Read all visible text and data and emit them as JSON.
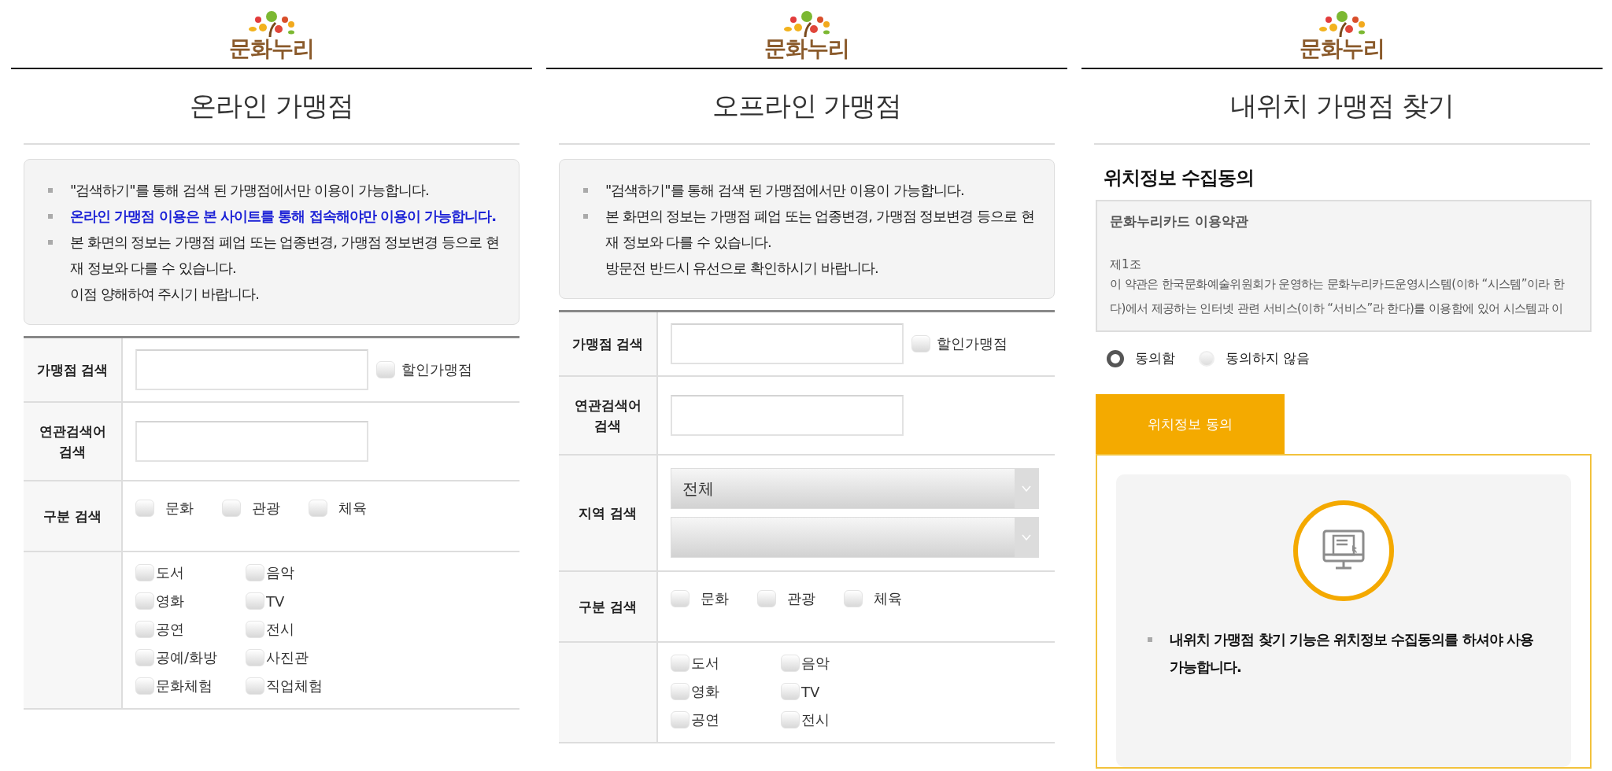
{
  "panels": [
    {
      "logo": "문화누리",
      "title": "온라인 가맹점",
      "kind": "search",
      "notice": [
        {
          "text": "\"검색하기\"를 통해 검색 된 가맹점에서만 이용이 가능합니다.",
          "emphasis": false
        },
        {
          "text": "온라인 가맹점 이용은 본 사이트를 통해 접속해야만 이용이 가능합니다.",
          "emphasis": true
        },
        {
          "text": "본 화면의 정보는 가맹점 폐업 또는 업종변경, 가맹점 정보변경 등으로 현재 정보와 다를 수 있습니다.",
          "emphasis": false,
          "note": "이점 양해하여 주시기 바랍니다."
        }
      ],
      "form": [
        {
          "kind": "search",
          "label": "가맹점 검색",
          "checkbox": {
            "label": "할인가맹점",
            "checked": false
          }
        },
        {
          "kind": "input",
          "label": "연관검색어\n검색"
        },
        {
          "kind": "checks",
          "label": "구분 검색",
          "options": [
            {
              "label": "문화",
              "checked": false
            },
            {
              "label": "관광",
              "checked": false
            },
            {
              "label": "체육",
              "checked": false
            }
          ]
        },
        {
          "kind": "grid",
          "options": [
            {
              "label": "도서",
              "checked": false
            },
            {
              "label": "음악",
              "checked": false
            },
            {
              "label": "영화",
              "checked": false
            },
            {
              "label": "TV",
              "checked": false
            },
            {
              "label": "공연",
              "checked": false
            },
            {
              "label": "전시",
              "checked": false
            },
            {
              "label": "공예/화방",
              "checked": false
            },
            {
              "label": "사진관",
              "checked": false
            },
            {
              "label": "문화체험",
              "checked": false
            },
            {
              "label": "직업체험",
              "checked": false
            }
          ]
        }
      ]
    },
    {
      "logo": "문화누리",
      "title": "오프라인 가맹점",
      "kind": "search",
      "notice": [
        {
          "text": "\"검색하기\"를 통해 검색 된 가맹점에서만 이용이 가능합니다.",
          "emphasis": false
        },
        {
          "text": "본 화면의 정보는 가맹점 폐업 또는 업종변경, 가맹점 정보변경 등으로 현재 정보와 다를 수 있습니다.",
          "emphasis": false,
          "note": "방문전 반드시 유선으로 확인하시기 바랍니다."
        }
      ],
      "form": [
        {
          "kind": "search",
          "label": "가맹점 검색",
          "checkbox": {
            "label": "할인가맹점",
            "checked": false
          }
        },
        {
          "kind": "input",
          "label": "연관검색어\n검색"
        },
        {
          "kind": "select",
          "label": "지역 검색",
          "selects": [
            {
              "kind": "filled",
              "value": "전체"
            },
            {
              "kind": "blank"
            }
          ]
        },
        {
          "kind": "checks",
          "label": "구분 검색",
          "options": [
            {
              "label": "문화",
              "checked": false
            },
            {
              "label": "관광",
              "checked": false
            },
            {
              "label": "체육",
              "checked": false
            }
          ]
        },
        {
          "kind": "grid",
          "options": [
            {
              "label": "도서",
              "checked": false
            },
            {
              "label": "음악",
              "checked": false
            },
            {
              "label": "영화",
              "checked": false
            },
            {
              "label": "TV",
              "checked": false
            },
            {
              "label": "공연",
              "checked": false
            },
            {
              "label": "전시",
              "checked": false
            }
          ]
        }
      ]
    },
    {
      "logo": "문화누리",
      "title": "내위치 가맹점 찾기",
      "kind": "consent",
      "consent": {
        "heading": "위치정보 수집동의",
        "terms_title": "문화누리카드 이용약관",
        "article": "제1조",
        "terms_text": "이 약관은 한국문화예술위원회가 운영하는 문화누리카드운영시스템(이하 “시스템”이라 한다)에서 제공하는 인터넷 관련 서비스(이하 “서비스”라 한다)를 이용함에 있어 시스템과 이",
        "radios": [
          {
            "label": "동의함",
            "selected": true
          },
          {
            "label": "동의하지 않음",
            "selected": false
          }
        ],
        "tabs": [
          {
            "label": "위치정보 동의",
            "selected": true
          }
        ],
        "message": "내위치 가맹점 찾기 기능은 위치정보 수집동의를 하셔야 사용 가능합니다."
      }
    }
  ]
}
